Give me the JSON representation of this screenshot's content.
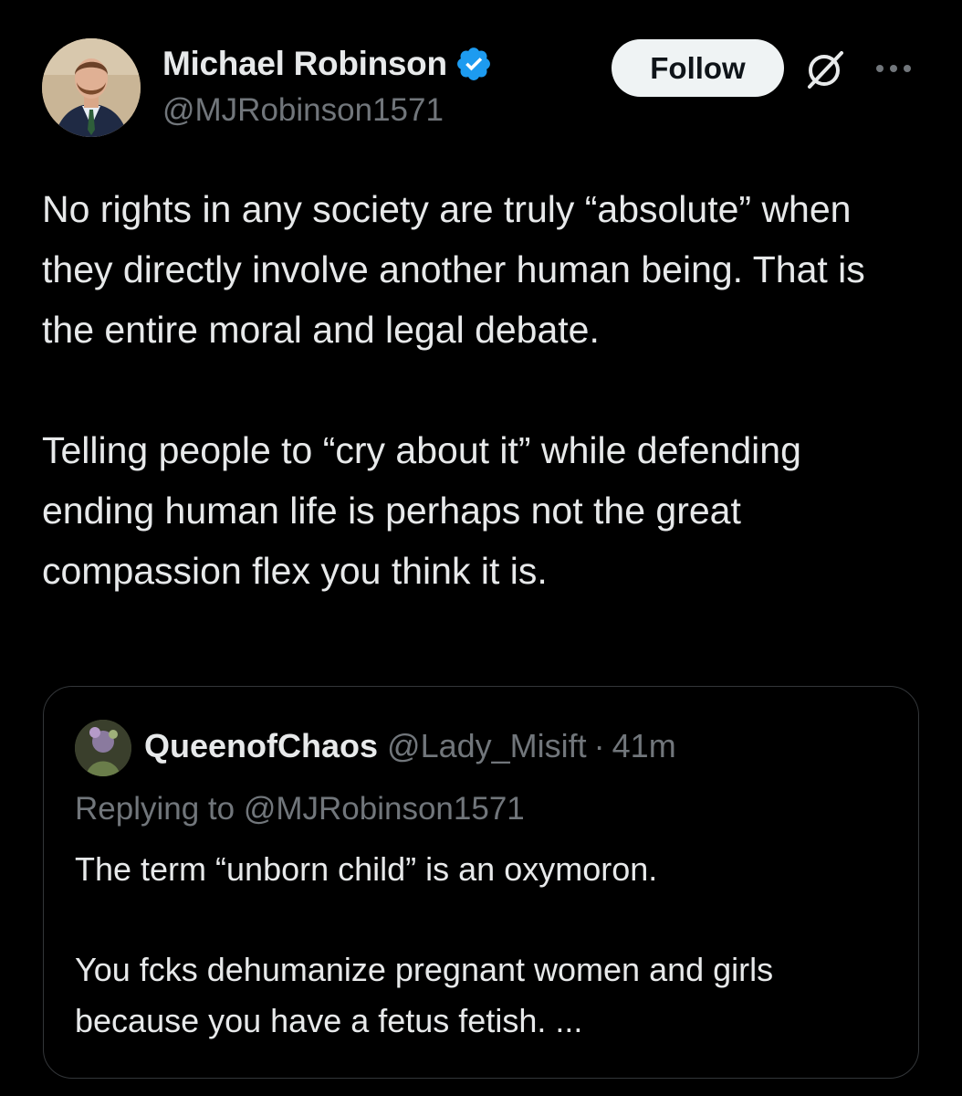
{
  "author": {
    "display_name": "Michael Robinson",
    "handle": "@MJRobinson1571",
    "verified_icon": "verified-badge-icon",
    "verified_color": "#1d9bf0"
  },
  "actions": {
    "follow_label": "Follow",
    "grok_icon": "grok-icon",
    "more_icon": "more-options-icon"
  },
  "tweet": {
    "paragraphs": [
      "No rights in any society are truly “absolute” when they directly involve another human being. That is the entire moral and legal debate.",
      "Telling people to “cry about it” while defending ending human life is perhaps not the great compassion flex you think it is."
    ]
  },
  "quote": {
    "display_name": "QueenofChaos",
    "handle": "@Lady_Misift",
    "separator": "·",
    "time": "41m",
    "replying_to": "Replying to @MJRobinson1571",
    "paragraphs": [
      "The term “unborn child” is an oxymoron.",
      "You fcks dehumanize pregnant women and girls because you have a fetus fetish. ..."
    ]
  },
  "colors": {
    "background": "#000000",
    "primary_text": "#e7e9ea",
    "secondary_text": "#71767b",
    "follow_bg": "#eff3f4",
    "card_border": "#333639"
  }
}
